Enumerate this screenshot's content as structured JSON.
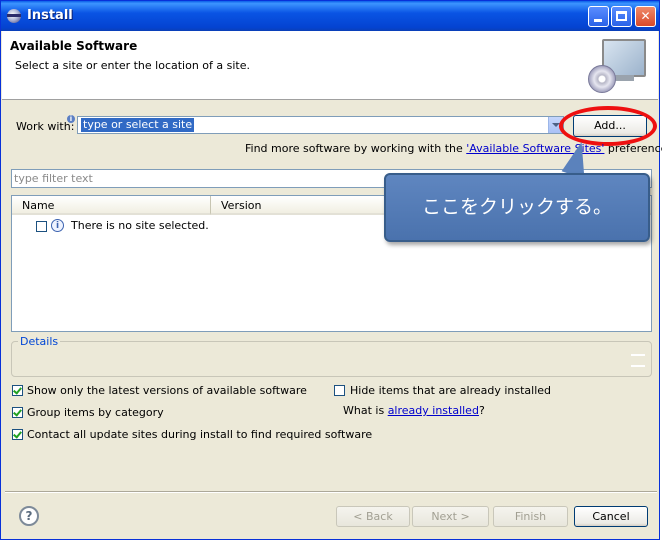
{
  "window": {
    "title": "Install"
  },
  "header": {
    "title": "Available Software",
    "subtitle": "Select a site or enter the location of a site."
  },
  "work_with": {
    "label": "Work with:",
    "value": "type or select a site",
    "add_label": "Add..."
  },
  "find_more": {
    "prefix": "Find more software by working with the ",
    "link": "'Available Software Sites'",
    "suffix": " preferences."
  },
  "filter": {
    "placeholder": "type filter text"
  },
  "table": {
    "columns": [
      "Name",
      "Version"
    ],
    "rows": [
      {
        "text": "There is no site selected."
      }
    ]
  },
  "callout": {
    "text": "ここをクリックする。"
  },
  "details": {
    "label": "Details"
  },
  "options": {
    "show_latest": {
      "label": "Show only the latest versions of available software",
      "checked": true
    },
    "hide_installed": {
      "label": "Hide items that are already installed",
      "checked": false
    },
    "what_is_prefix": "What is ",
    "what_is_link": "already installed",
    "what_is_suffix": "?",
    "group_items": {
      "label": "Group items by category",
      "checked": true
    },
    "contact_sites": {
      "label": "Contact all update sites during install to find required software",
      "checked": true
    }
  },
  "buttons": {
    "help": "?",
    "back": "< Back",
    "next": "Next >",
    "finish": "Finish",
    "cancel": "Cancel"
  },
  "colors": {
    "titlebar": "#0a54e4",
    "callout": "#4f78b4",
    "highlight": "#ee1010",
    "link": "#0000cc"
  }
}
